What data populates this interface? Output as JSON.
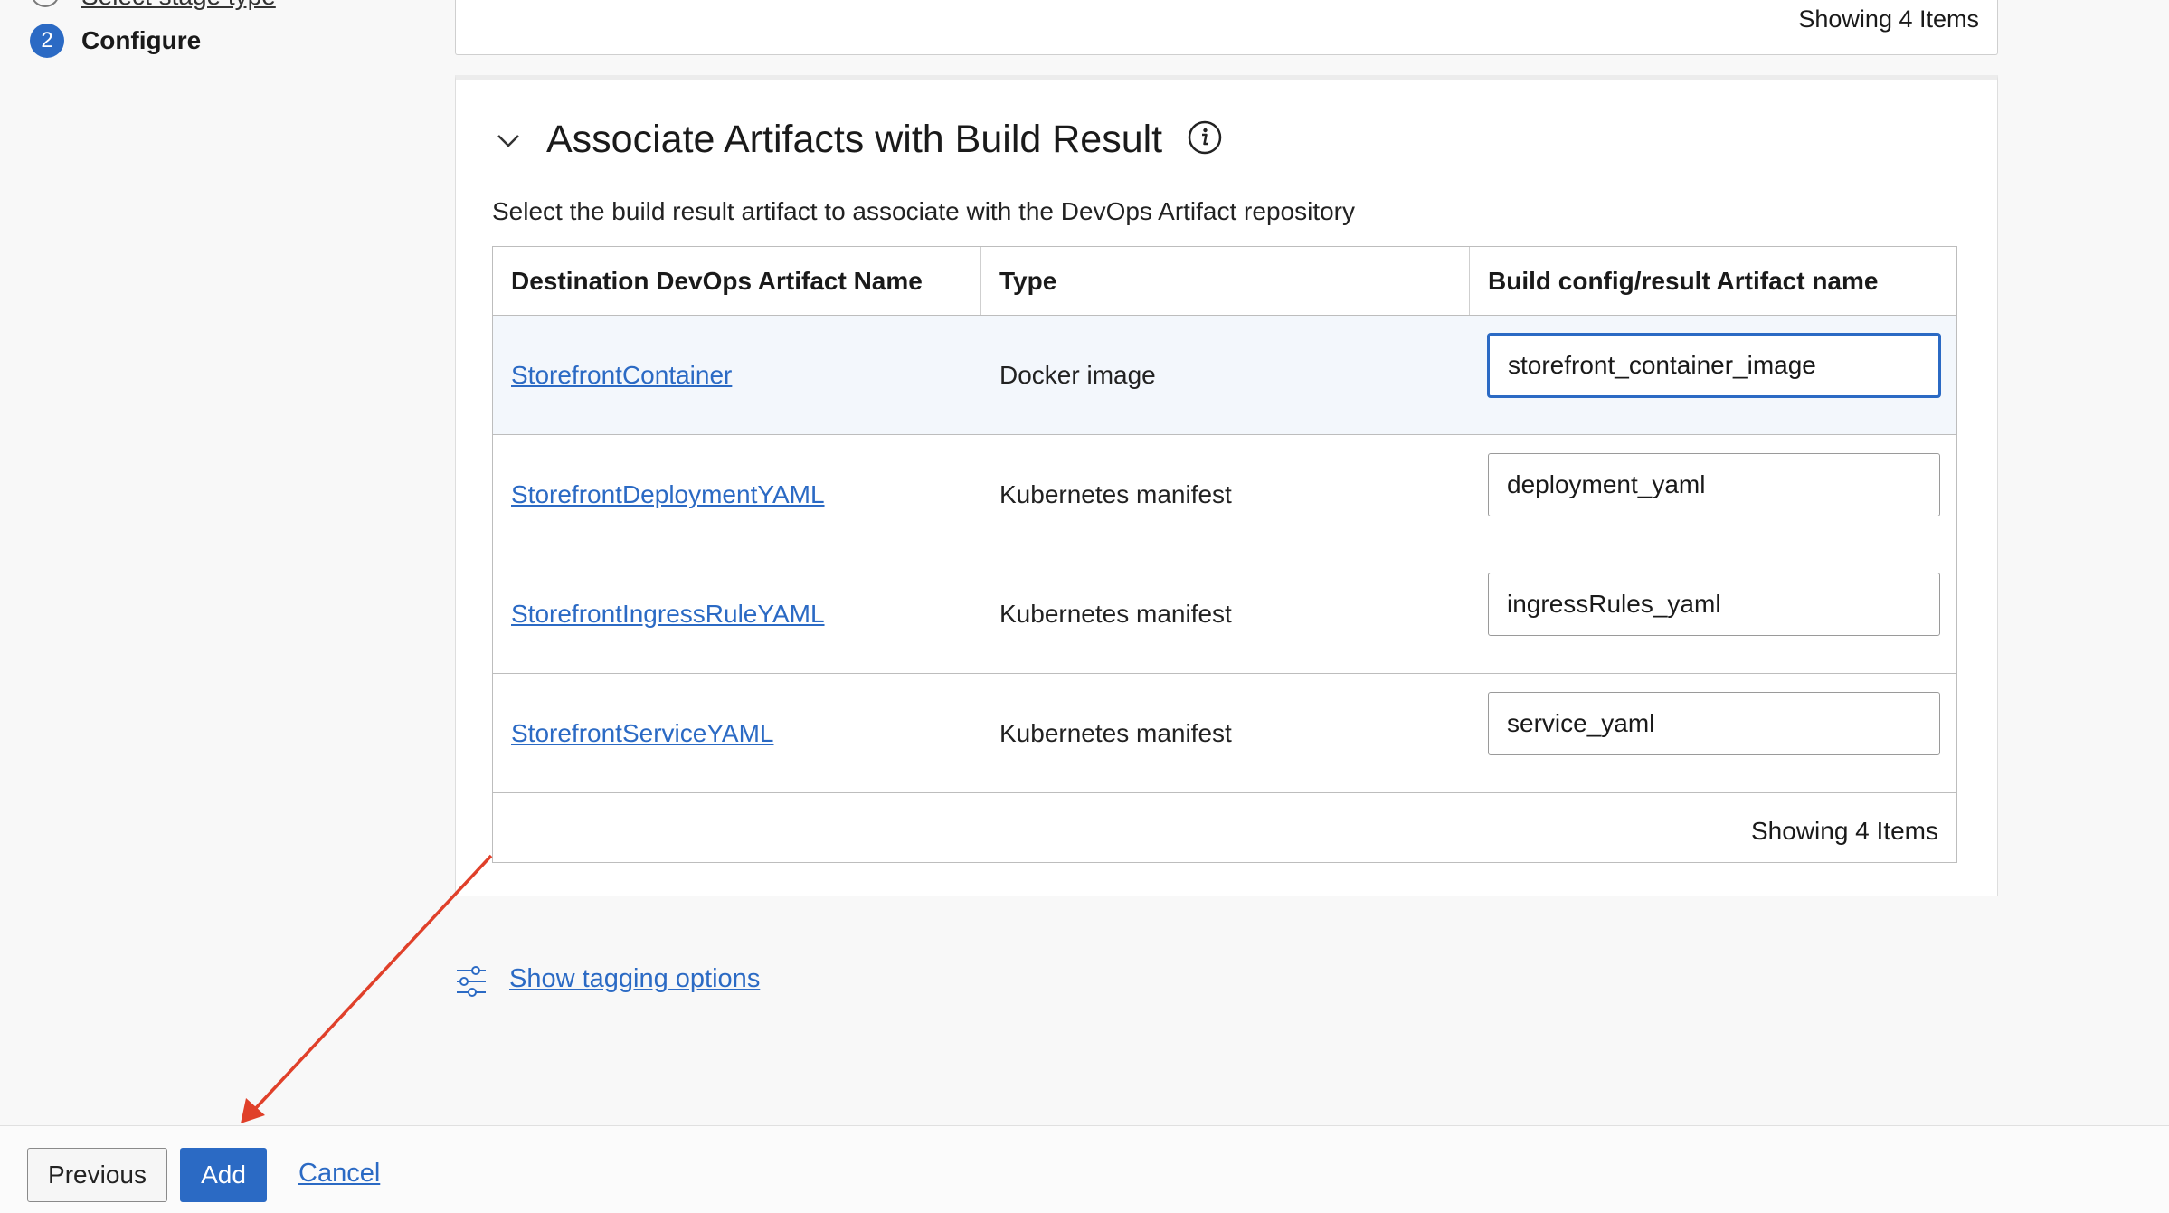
{
  "stepper": {
    "previous_step_label": "Select stage type",
    "current_step_number": "2",
    "current_step_label": "Configure"
  },
  "top_panel": {
    "showing": "Showing 4 Items"
  },
  "section": {
    "title": "Associate Artifacts with Build Result",
    "description": "Select the build result artifact to associate with the DevOps Artifact repository"
  },
  "table": {
    "headers": [
      "Destination DevOps Artifact Name",
      "Type",
      "Build config/result Artifact name"
    ],
    "rows": [
      {
        "name": "StorefrontContainer",
        "type": "Docker image",
        "value": "storefront_container_image"
      },
      {
        "name": "StorefrontDeploymentYAML",
        "type": "Kubernetes manifest",
        "value": "deployment_yaml"
      },
      {
        "name": "StorefrontIngressRuleYAML",
        "type": "Kubernetes manifest",
        "value": "ingressRules_yaml"
      },
      {
        "name": "StorefrontServiceYAML",
        "type": "Kubernetes manifest",
        "value": "service_yaml"
      }
    ],
    "footer": "Showing 4 Items"
  },
  "tagging": {
    "label": "Show tagging options",
    "icon": "sliders-icon"
  },
  "footer": {
    "previous": "Previous",
    "add": "Add",
    "cancel": "Cancel"
  },
  "colors": {
    "accent": "#2b6ac4",
    "annotation_arrow": "#e0402a"
  }
}
